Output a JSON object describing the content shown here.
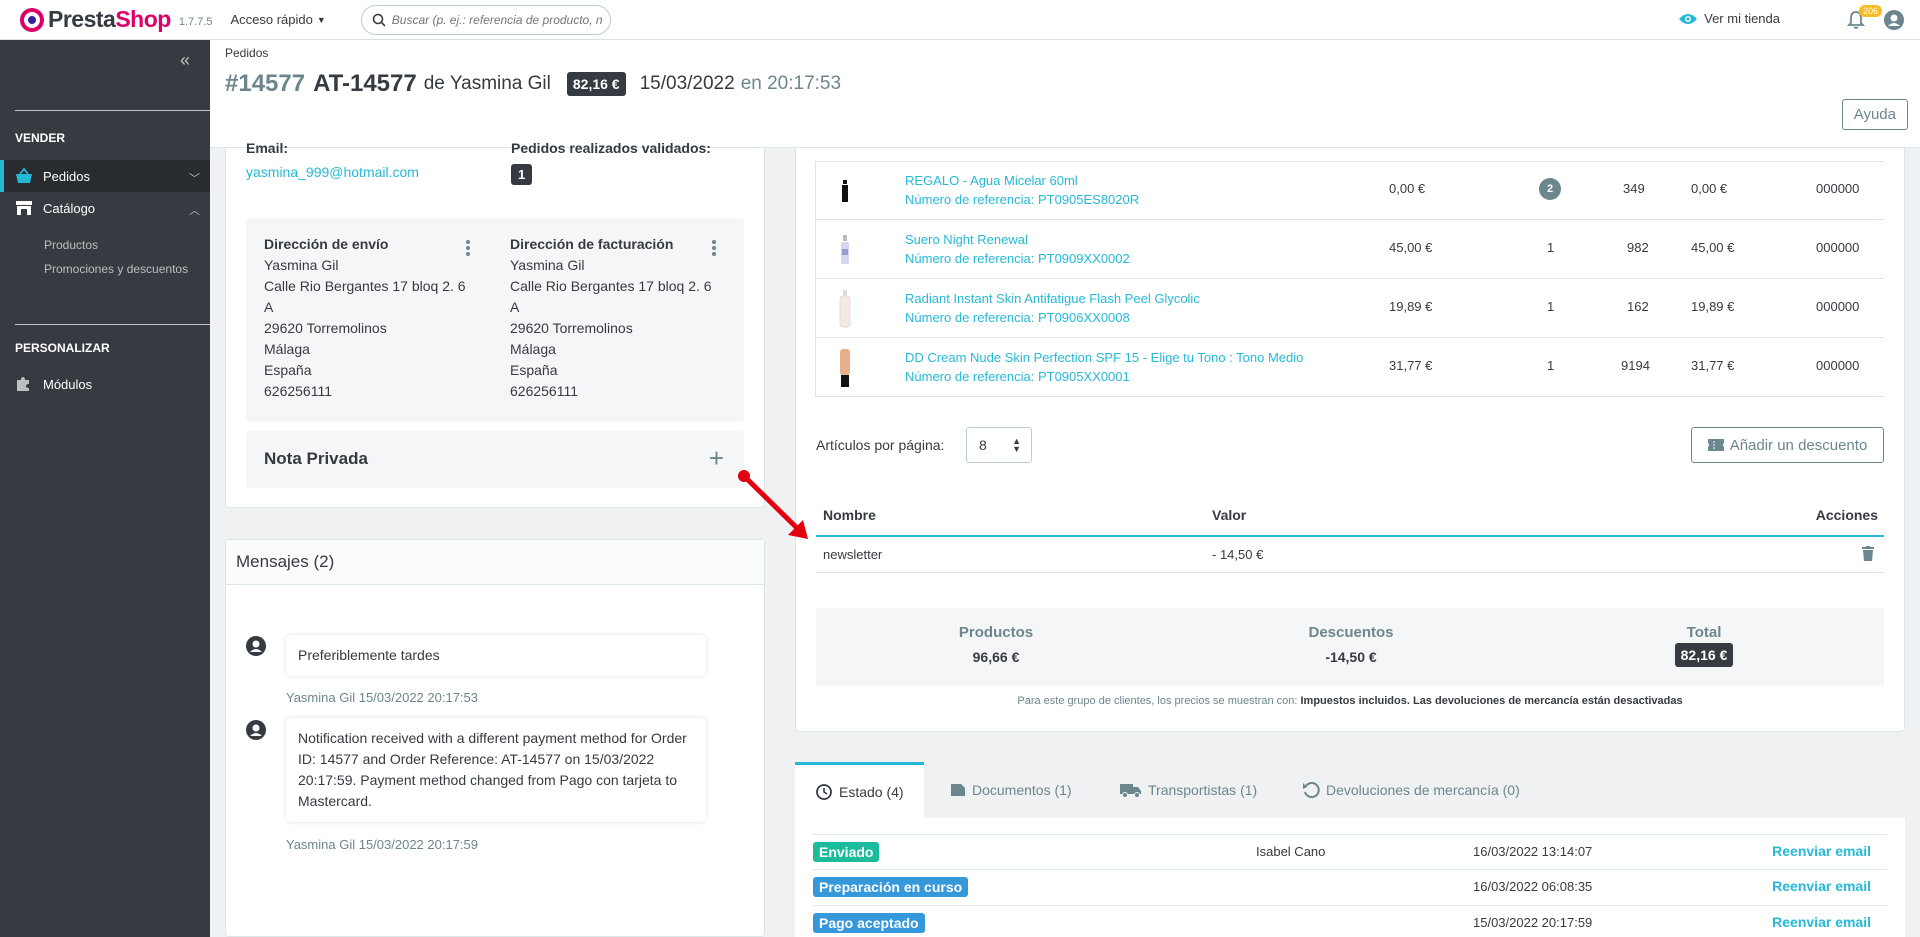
{
  "topbar": {
    "logo_text_1": "Presta",
    "logo_text_2": "Shop",
    "version": "1.7.7.5",
    "quick_access": "Acceso rápido",
    "search_placeholder": "Buscar (p. ej.: referencia de producto, nombre de cliente...)",
    "view_store": "Ver mi tienda",
    "notifications_count": "206"
  },
  "sidebar": {
    "section_sell": "VENDER",
    "items": [
      {
        "label": "Pedidos",
        "active": true
      },
      {
        "label": "Catálogo",
        "active": false
      }
    ],
    "catalog_sub": [
      "Productos",
      "Promociones y descuentos"
    ],
    "section_customize": "PERSONALIZAR",
    "modules": "Módulos"
  },
  "header": {
    "breadcrumb": "Pedidos",
    "order_number": "#14577",
    "order_reference": "AT-14577",
    "de": "de",
    "customer": "Yasmina Gil",
    "total_badge": "82,16 €",
    "date": "15/03/2022",
    "en_time": "en 20:17:53",
    "help": "Ayuda"
  },
  "customer": {
    "email_label": "Email:",
    "email": "yasmina_999@hotmail.com",
    "orders_label": "Pedidos realizados validados:",
    "orders_count": "1",
    "shipping": {
      "title": "Dirección de envío",
      "lines": [
        "Yasmina Gil",
        "Calle Rio Bergantes 17 bloq 2. 6",
        "A",
        "29620 Torremolinos",
        "Málaga",
        "España",
        "626256111"
      ]
    },
    "billing": {
      "title": "Dirección de facturación",
      "lines": [
        "Yasmina Gil",
        "Calle Rio Bergantes 17 bloq 2. 6",
        "A",
        "29620 Torremolinos",
        "Málaga",
        "España",
        "626256111"
      ]
    },
    "private_note": "Nota Privada"
  },
  "messages": {
    "title": "Mensajes (2)",
    "items": [
      {
        "text": "Preferiblemente tardes",
        "author": "Yasmina Gil 15/03/2022 20:17:53"
      },
      {
        "text": "Notification received with a different payment method for Order ID: 14577 and Order Reference: AT-14577 on 15/03/2022 20:17:59. Payment method changed from Pago con tarjeta to Mastercard.",
        "author": "Yasmina Gil 15/03/2022 20:17:59"
      }
    ]
  },
  "products": [
    {
      "name": "REGALO - Agua Micelar 60ml",
      "ref": "Número de referencia: PT0905ES8020R",
      "price": "0,00 €",
      "qty": "2",
      "stock": "349",
      "total": "0,00 €",
      "code": "000000"
    },
    {
      "name": "Suero Night Renewal",
      "ref": "Número de referencia: PT0909XX0002",
      "price": "45,00 €",
      "qty": "1",
      "stock": "982",
      "total": "45,00 €",
      "code": "000000"
    },
    {
      "name": "Radiant Instant Skin Antifatigue Flash Peel Glycolic",
      "ref": "Número de referencia: PT0906XX0008",
      "price": "19,89 €",
      "qty": "1",
      "stock": "162",
      "total": "19,89 €",
      "code": "000000"
    },
    {
      "name": "DD Cream Nude Skin Perfection SPF 15 - Elige tu Tono : Tono Medio",
      "ref": "Número de referencia: PT0905XX0001",
      "price": "31,77 €",
      "qty": "1",
      "stock": "9194",
      "total": "31,77 €",
      "code": "000000"
    }
  ],
  "pagination": {
    "label": "Artículos por página:",
    "value": "8"
  },
  "add_discount": "Añadir un descuento",
  "discounts": {
    "headers": {
      "name": "Nombre",
      "value": "Valor",
      "actions": "Acciones"
    },
    "rows": [
      {
        "name": "newsletter",
        "value": "- 14,50 €"
      }
    ]
  },
  "totals": {
    "products_label": "Productos",
    "products_value": "96,66 €",
    "discounts_label": "Descuentos",
    "discounts_value": "-14,50 €",
    "total_label": "Total",
    "total_value": "82,16 €"
  },
  "tax_note": {
    "prefix": "Para este grupo de clientes, los precios se muestran con: ",
    "tax": "Impuestos incluidos",
    "returns": ". Las devoluciones de mercancía están desactivadas"
  },
  "tabs": [
    {
      "label": "Estado (4)"
    },
    {
      "label": "Documentos (1)"
    },
    {
      "label": "Transportistas (1)"
    },
    {
      "label": "Devoluciones de mercancía (0)"
    }
  ],
  "history": [
    {
      "status": "Enviado",
      "color": "#70b580",
      "employee": "Isabel Cano",
      "date": "16/03/2022 13:14:07",
      "action": "Reenviar email"
    },
    {
      "status": "Preparación en curso",
      "color": "#3498db",
      "employee": "",
      "date": "16/03/2022 06:08:35",
      "action": "Reenviar email"
    },
    {
      "status": "Pago aceptado",
      "color": "#3498db",
      "employee": "",
      "date": "15/03/2022 20:17:59",
      "action": "Reenviar email"
    }
  ],
  "colors": {
    "accent": "#25b9d7",
    "brand": "#df0067",
    "sidebar": "#363a41",
    "annotation_arrow": "#e3000f",
    "success": "#1abc9c"
  }
}
